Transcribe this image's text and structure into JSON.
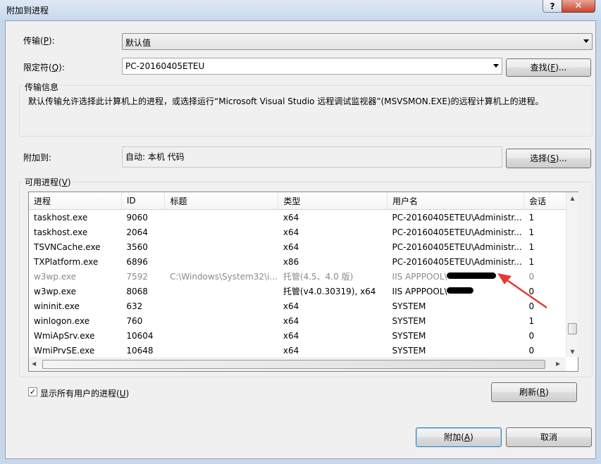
{
  "window": {
    "title": "附加到进程",
    "help_label": "?",
    "close_label": "✕"
  },
  "transport": {
    "label": "传输(P):",
    "value": "默认值"
  },
  "qualifier": {
    "label": "限定符(Q):",
    "value": "PC-20160405ETEU",
    "find_button": "查找(F)..."
  },
  "transport_info": {
    "title": "传输信息",
    "text": "默认传输允许选择此计算机上的进程，或选择运行“Microsoft Visual Studio 远程调试监视器”(MSVSMON.EXE)的远程计算机上的进程。"
  },
  "attach_to": {
    "label": "附加到:",
    "value": "自动: 本机 代码",
    "select_button": "选择(S)..."
  },
  "processes": {
    "title": "可用进程(V)",
    "columns": [
      "进程",
      "ID",
      "标题",
      "类型",
      "用户名",
      "会话"
    ],
    "rows": [
      [
        "taskhost.exe",
        "9060",
        "",
        "x64",
        "PC-20160405ETEU\\Administr...",
        "1"
      ],
      [
        "taskhost.exe",
        "2064",
        "",
        "x64",
        "PC-20160405ETEU\\Administr...",
        "1"
      ],
      [
        "TSVNCache.exe",
        "3560",
        "",
        "x64",
        "PC-20160405ETEU\\Administr...",
        "1"
      ],
      [
        "TXPlatform.exe",
        "6896",
        "",
        "x86",
        "PC-20160405ETEU\\Administr...",
        "1"
      ],
      [
        "w3wp.exe",
        "7592",
        "C:\\Windows\\System32\\i...",
        "托管(4.5、4.0 版)",
        "IIS APPPOOL\\",
        "0"
      ],
      [
        "w3wp.exe",
        "8068",
        "",
        "托管(v4.0.30319), x64",
        "IIS APPPOOL\\",
        "0"
      ],
      [
        "wininit.exe",
        "632",
        "",
        "x64",
        "SYSTEM",
        "0"
      ],
      [
        "winlogon.exe",
        "760",
        "",
        "x64",
        "SYSTEM",
        "1"
      ],
      [
        "WmiApSrv.exe",
        "10604",
        "",
        "x64",
        "SYSTEM",
        "0"
      ],
      [
        "WmiPrvSE.exe",
        "10648",
        "",
        "x64",
        "SYSTEM",
        "0"
      ]
    ],
    "dimmed_row": 4
  },
  "show_all_users": {
    "label": "显示所有用户的进程(U)",
    "checked": true,
    "check_glyph": "✓"
  },
  "buttons": {
    "refresh": "刷新(R)",
    "attach": "附加(A)",
    "cancel": "取消"
  },
  "colors": {
    "annotation_arrow": "#e53935",
    "close_button": "#c7452f"
  }
}
